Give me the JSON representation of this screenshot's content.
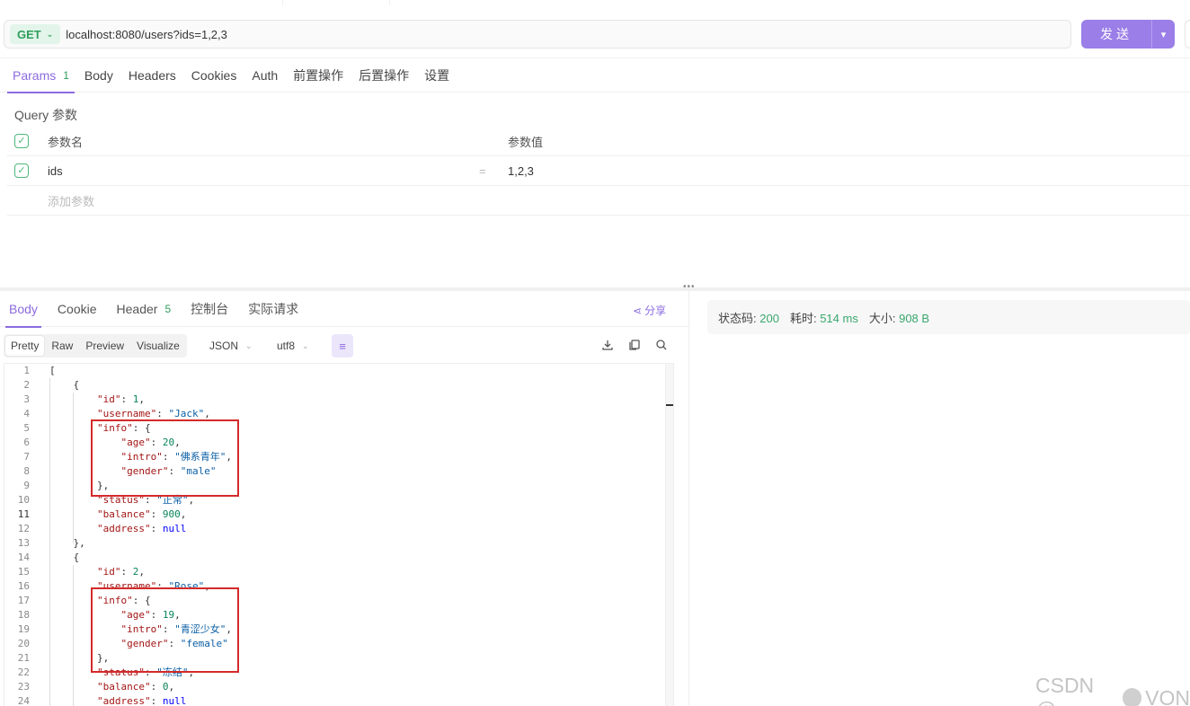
{
  "request": {
    "method": "GET",
    "url": "localhost:8080/users?ids=1,2,3",
    "send_label": "发送"
  },
  "req_tabs": [
    {
      "label": "Params",
      "count": "1"
    },
    {
      "label": "Body"
    },
    {
      "label": "Headers"
    },
    {
      "label": "Cookies"
    },
    {
      "label": "Auth"
    },
    {
      "label": "前置操作"
    },
    {
      "label": "后置操作"
    },
    {
      "label": "设置"
    }
  ],
  "params": {
    "title": "Query 参数",
    "header_key": "参数名",
    "header_value": "参数值",
    "rows": [
      {
        "key": "ids",
        "eq": "=",
        "value": "1,2,3"
      }
    ],
    "add_placeholder": "添加参数"
  },
  "resp_tabs": [
    {
      "label": "Body"
    },
    {
      "label": "Cookie"
    },
    {
      "label": "Header",
      "count": "5"
    },
    {
      "label": "控制台"
    },
    {
      "label": "实际请求"
    }
  ],
  "share_label": "分享",
  "view_modes": [
    "Pretty",
    "Raw",
    "Preview",
    "Visualize"
  ],
  "format": "JSON",
  "encoding": "utf8",
  "status": {
    "code_label": "状态码:",
    "code": "200",
    "time_label": "耗时:",
    "time": "514 ms",
    "size_label": "大小:",
    "size": "908 B"
  },
  "watermark": {
    "text_left": "CSDN @",
    "text_right": "VON"
  },
  "colors": {
    "accent": "#9b7ee8",
    "success": "#2f9e5b",
    "highlight_box": "#d42a2a"
  }
}
